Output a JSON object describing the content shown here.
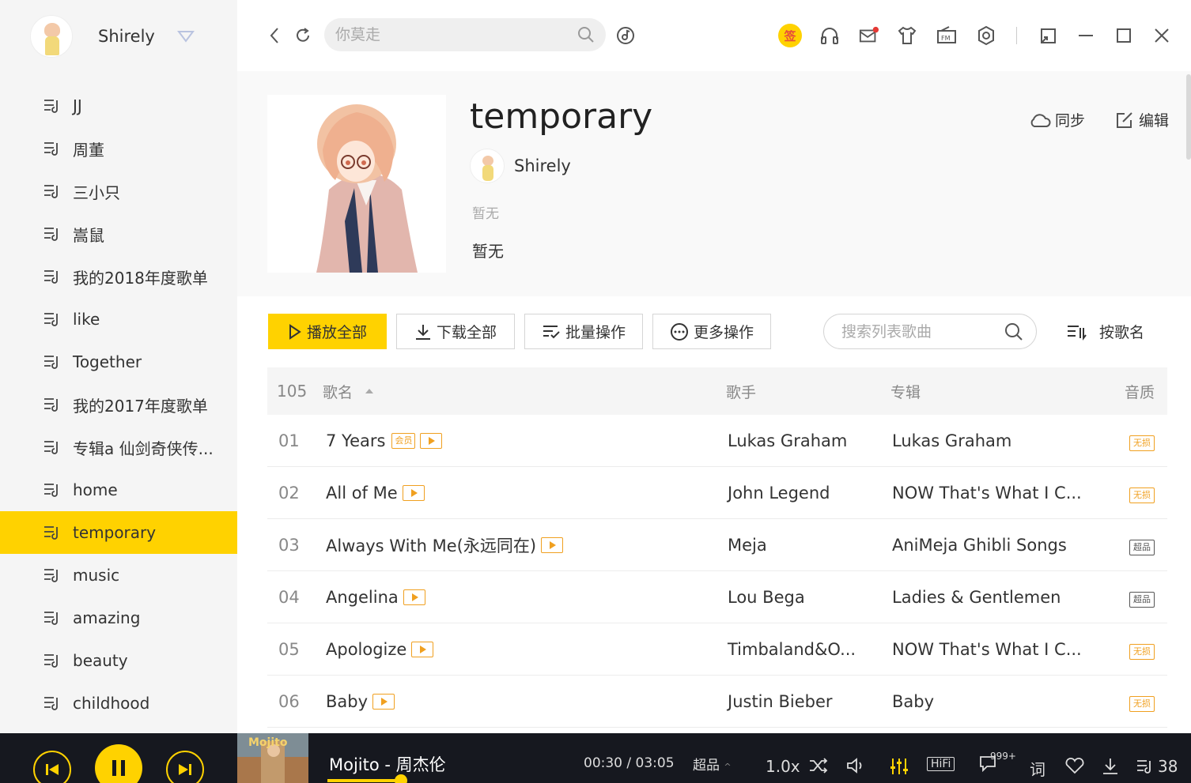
{
  "sidebar": {
    "username": "Shirely",
    "playlists": [
      "JJ",
      "周董",
      "三小只",
      "嵩鼠",
      "我的2018年度歌单",
      "like",
      "Together",
      "我的2017年度歌单",
      "专辑a 仙剑奇侠传...",
      "home",
      "temporary",
      "music",
      "amazing",
      "beauty",
      "childhood"
    ],
    "active_index": 10
  },
  "topbar": {
    "search_placeholder": "你莫走",
    "sign_label": "签"
  },
  "playlist": {
    "title": "temporary",
    "creator": "Shirely",
    "tags": "暂无",
    "description": "暂无",
    "sync_label": "同步",
    "edit_label": "编辑"
  },
  "toolbar": {
    "play_all": "播放全部",
    "download_all": "下载全部",
    "batch": "批量操作",
    "more": "更多操作",
    "search_placeholder": "搜索列表歌曲",
    "sort_label": "按歌名"
  },
  "table": {
    "count": "105",
    "headers": {
      "name": "歌名",
      "artist": "歌手",
      "album": "专辑",
      "quality": "音质"
    },
    "rows": [
      {
        "idx": "01",
        "name": "7 Years",
        "artist": "Lukas Graham",
        "album": "Lukas Graham",
        "quality": "无损",
        "vip": "会员"
      },
      {
        "idx": "02",
        "name": "All of Me",
        "artist": "John Legend",
        "album": "NOW That's What I C...",
        "quality": "无损"
      },
      {
        "idx": "03",
        "name": "Always With Me(永远同在)",
        "artist": "Meja",
        "album": "AniMeja Ghibli Songs",
        "quality": "超品"
      },
      {
        "idx": "04",
        "name": "Angelina",
        "artist": "Lou Bega",
        "album": "Ladies & Gentlemen",
        "quality": "超品"
      },
      {
        "idx": "05",
        "name": "Apologize",
        "artist": "Timbaland&O...",
        "album": "NOW That's What I C...",
        "quality": "无损"
      },
      {
        "idx": "06",
        "name": "Baby",
        "artist": "Justin Bieber",
        "album": "Baby",
        "quality": "无损"
      }
    ]
  },
  "player": {
    "song": "Mojito - 周杰伦",
    "time": "00:30 / 03:05",
    "quality": "超品",
    "speed": "1.0x",
    "hifi": "HiFi",
    "comment_count": "999+",
    "lyric": "词",
    "queue_count": "38",
    "cover_text": "Mojito",
    "progress": 0.16
  },
  "colors": {
    "accent": "#ffd200",
    "badge": "#f0a020",
    "player_bg": "#16181f"
  }
}
